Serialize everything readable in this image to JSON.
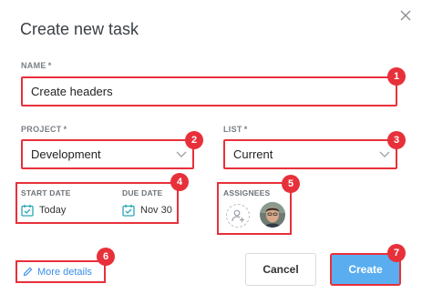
{
  "dialog": {
    "title": "Create new task",
    "close_icon": "close-icon"
  },
  "name": {
    "label": "NAME",
    "required": "*",
    "value": "Create headers"
  },
  "project": {
    "label": "PROJECT",
    "required": "*",
    "value": "Development"
  },
  "list": {
    "label": "LIST",
    "required": "*",
    "value": "Current"
  },
  "dates": {
    "start_label": "START DATE",
    "start_value": "Today",
    "due_label": "DUE DATE",
    "due_value": "Nov 30"
  },
  "assignees": {
    "label": "ASSIGNEES"
  },
  "footer": {
    "more_details": "More details",
    "cancel": "Cancel",
    "create": "Create"
  },
  "badges": [
    "1",
    "2",
    "3",
    "4",
    "5",
    "6",
    "7"
  ],
  "colors": {
    "highlight": "#e8303a",
    "primary": "#5aaef0",
    "link": "#3a8ee6",
    "calendar_icon": "#2aa6b5"
  }
}
